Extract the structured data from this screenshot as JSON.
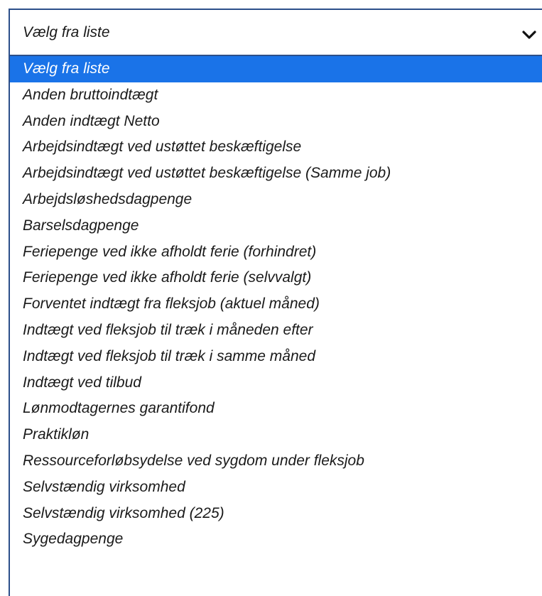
{
  "select": {
    "value": "Vælg fra liste",
    "options": [
      {
        "label": "Vælg fra liste",
        "selected": true
      },
      {
        "label": "Anden bruttoindtægt"
      },
      {
        "label": "Anden indtægt Netto"
      },
      {
        "label": "Arbejdsindtægt ved ustøttet beskæftigelse"
      },
      {
        "label": "Arbejdsindtægt ved ustøttet beskæftigelse (Samme job)"
      },
      {
        "label": "Arbejdsløshedsdagpenge"
      },
      {
        "label": "Barselsdagpenge"
      },
      {
        "label": "Feriepenge ved ikke afholdt ferie (forhindret)"
      },
      {
        "label": "Feriepenge ved ikke afholdt ferie (selvvalgt)"
      },
      {
        "label": "Forventet indtægt fra fleksjob (aktuel måned)"
      },
      {
        "label": "Indtægt ved fleksjob til træk i måneden efter"
      },
      {
        "label": "Indtægt ved fleksjob til træk i samme måned"
      },
      {
        "label": "Indtægt ved tilbud"
      },
      {
        "label": "Lønmodtagernes garantifond"
      },
      {
        "label": "Praktikløn"
      },
      {
        "label": "Ressourceforløbsydelse ved sygdom under fleksjob"
      },
      {
        "label": "Selvstændig virksomhed"
      },
      {
        "label": "Selvstændig virksomhed (225)"
      },
      {
        "label": "Sygedagpenge"
      }
    ]
  },
  "icons": {
    "chevron": "chevron-down-icon"
  },
  "colors": {
    "selected_bg": "#1a73e8",
    "border": "#2c4f8a"
  }
}
